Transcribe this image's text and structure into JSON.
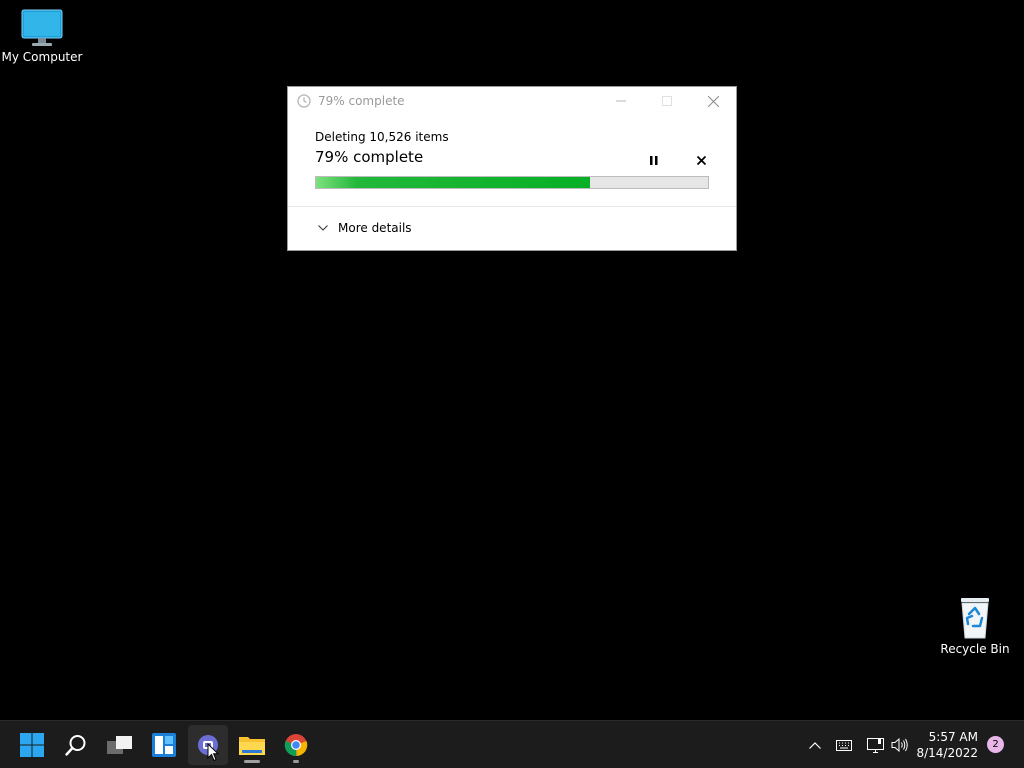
{
  "desktop": {
    "icons": [
      {
        "label": "My Computer",
        "icon": "computer-icon"
      },
      {
        "label": "Recycle Bin",
        "icon": "recycle-bin-icon"
      }
    ]
  },
  "dialog": {
    "title": "79% complete",
    "operation": "Deleting 10,526 items",
    "percent_text": "79% complete",
    "progress_fraction": 0.7,
    "more_details": "More details",
    "controls": {
      "minimize": "minimize-icon",
      "maximize": "maximize-icon",
      "close": "close-icon",
      "pause": "pause-icon",
      "cancel": "cancel-icon"
    }
  },
  "taskbar": {
    "apps": [
      "start-icon",
      "search-icon",
      "task-view-icon",
      "widgets-icon",
      "chat-icon",
      "file-explorer-icon",
      "chrome-icon"
    ],
    "tray": [
      "chevron-up-icon",
      "keyboard-icon",
      "network-icon",
      "volume-icon"
    ],
    "time": "5:57 AM",
    "date": "8/14/2022",
    "notification_count": "2"
  },
  "colors": {
    "progress": "#06b025",
    "desktop": "#000000",
    "taskbar": "#1c1c1c"
  }
}
